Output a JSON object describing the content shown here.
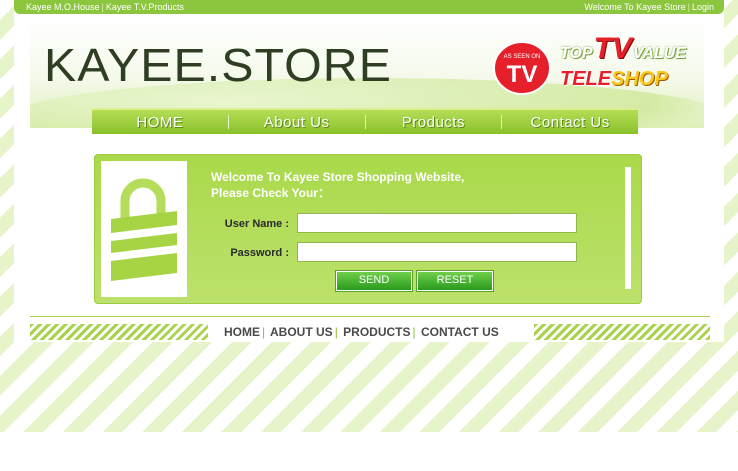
{
  "topbar": {
    "left_links": [
      "Kayee M.O.House",
      "Kayee T.V.Products"
    ],
    "welcome": "Welcome To Kayee Store",
    "login": "Login"
  },
  "header": {
    "logo": "KAYEE.STORE",
    "badge_small": "AS SEEN ON",
    "badge_big": "TV",
    "top_value_top": "TOP",
    "top_value_tv": "TV",
    "top_value_value": "VALUE",
    "tele": "TELE",
    "shop": "SHOP"
  },
  "nav": [
    "HOME",
    "About Us",
    "Products",
    "Contact Us"
  ],
  "login": {
    "welcome_line1": "Welcome To Kayee Store Shopping Website,",
    "welcome_line2": "Please Check Your：",
    "username_label": "User Name :",
    "password_label": "Password :",
    "username_value": "",
    "password_value": "",
    "send": "SEND",
    "reset": "RESET"
  },
  "footer": [
    "HOME",
    "ABOUT US",
    "PRODUCTS",
    "CONTACT US"
  ],
  "colors": {
    "accent": "#8cc63f",
    "button": "#2a9a1e",
    "logo": "#2f3d22"
  }
}
